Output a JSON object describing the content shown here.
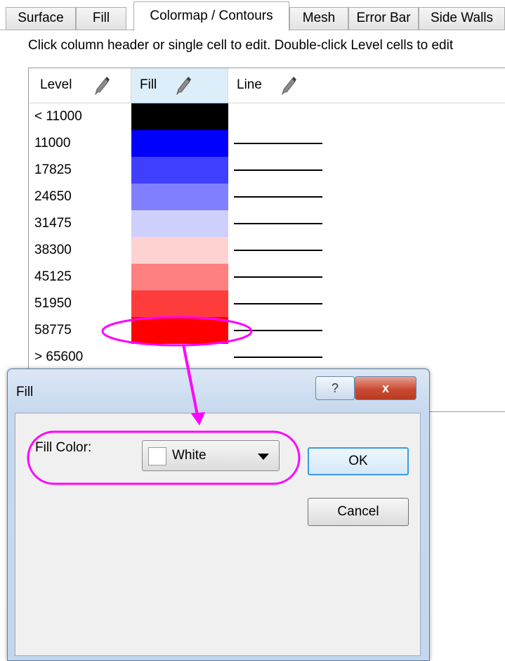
{
  "tabs": [
    {
      "label": "Surface"
    },
    {
      "label": "Fill"
    },
    {
      "label": "Colormap / Contours"
    },
    {
      "label": "Mesh"
    },
    {
      "label": "Error Bar"
    },
    {
      "label": "Side Walls"
    }
  ],
  "active_tab": "Colormap / Contours",
  "instruction": "Click column header or single cell to edit. Double-click Level cells to edit",
  "grid": {
    "columns": [
      {
        "label": "Level",
        "icon": "pencil-icon"
      },
      {
        "label": "Fill",
        "icon": "pencil-icon"
      },
      {
        "label": "Line",
        "icon": "pencil-icon"
      }
    ],
    "rows": [
      {
        "level": "< 11000",
        "fill_color": "#000000"
      },
      {
        "level": "11000",
        "fill_color": "#0000ff"
      },
      {
        "level": "17825",
        "fill_color": "#3f3fff"
      },
      {
        "level": "24650",
        "fill_color": "#8080ff"
      },
      {
        "level": "31475",
        "fill_color": "#cfcffe"
      },
      {
        "level": "38300",
        "fill_color": "#ffd2d2"
      },
      {
        "level": "45125",
        "fill_color": "#ff8080"
      },
      {
        "level": "51950",
        "fill_color": "#ff3c3c"
      },
      {
        "level": "58775",
        "fill_color": "#ff0000"
      },
      {
        "level": "> 65600",
        "fill_color": "#ffffff"
      }
    ]
  },
  "dialog": {
    "title": "Fill",
    "help_label": "?",
    "close_label": "x",
    "fill_color_label": "Fill Color:",
    "fill_color_value": "White",
    "ok_label": "OK",
    "cancel_label": "Cancel"
  },
  "colors": {
    "annotation": "#ff00ff",
    "header_selected": "#dceefa",
    "dialog_frame": "#c7d9ee"
  }
}
